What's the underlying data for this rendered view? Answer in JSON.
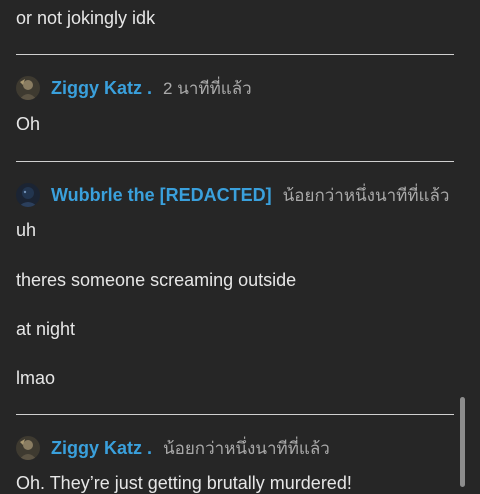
{
  "messages_before": {
    "tail_text": "or not jokingly idk"
  },
  "posts": [
    {
      "author": "Ziggy Katz .",
      "time": "2 นาทีที่แล้ว",
      "avatar_icon": "ziggy-avatar",
      "lines": [
        "Oh"
      ]
    },
    {
      "author": "Wubbrle the [REDACTED]",
      "time": "น้อยกว่าหนึ่งนาทีที่แล้ว",
      "avatar_icon": "wubbrle-avatar",
      "lines": [
        "uh",
        "theres someone screaming outside",
        "at night",
        "lmao"
      ]
    },
    {
      "author": "Ziggy Katz .",
      "time": "น้อยกว่าหนึ่งนาทีที่แล้ว",
      "avatar_icon": "ziggy-avatar",
      "lines": [
        "Oh. They’re just getting brutally murdered!"
      ]
    }
  ],
  "colors": {
    "background": "#262626",
    "text": "#e6e6e6",
    "author": "#3aa0dc",
    "timestamp": "#a9a9a9",
    "divider": "#d0d0d0"
  }
}
